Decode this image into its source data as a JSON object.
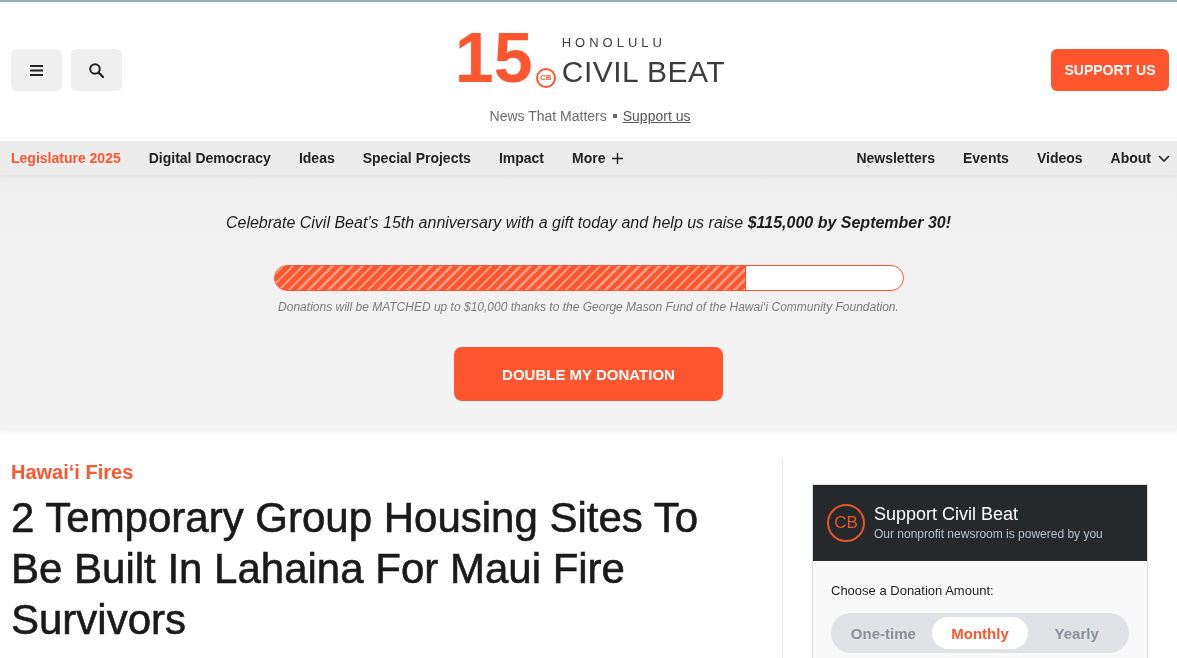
{
  "header": {
    "logo": {
      "number": "15",
      "badge": "CB",
      "city": "HONOLULU",
      "name": "CIVIL BEAT"
    },
    "tagline": "News That Matters",
    "tagline_link": "Support us",
    "support_button": "SUPPORT US"
  },
  "nav": {
    "left": [
      {
        "label": "Legislature 2025",
        "kind": "featured"
      },
      {
        "label": "Digital Democracy",
        "kind": "link"
      },
      {
        "label": "Ideas",
        "kind": "link"
      },
      {
        "label": "Special Projects",
        "kind": "link"
      },
      {
        "label": "Impact",
        "kind": "link"
      },
      {
        "label": "More",
        "kind": "more"
      }
    ],
    "right": [
      {
        "label": "Newsletters",
        "kind": "link"
      },
      {
        "label": "Events",
        "kind": "link"
      },
      {
        "label": "Videos",
        "kind": "link"
      },
      {
        "label": "About",
        "kind": "dropdown"
      }
    ]
  },
  "banner": {
    "message": "Celebrate Civil Beat’s 15th anniversary with a gift today and help us raise **$115,000 by September 30!**",
    "progress": {
      "level": 0.75
    },
    "note": "Donations will be MATCHED up to $10,000 thanks to the George Mason Fund of the Hawai‘i Community Foundation.",
    "button": "DOUBLE MY DONATION"
  },
  "article": {
    "category": "Hawai‘i Fires",
    "headline": "2 Temporary Group Housing Sites To Be Built In Lahaina For Maui Fire Survivors"
  },
  "donation_widget": {
    "logo": "CB",
    "title": "Support Civil Beat",
    "subtitle": "Our nonprofit newsroom is powered by you",
    "prompt": "Choose a Donation Amount:",
    "frequencies": [
      {
        "label": "One-time",
        "selected": false
      },
      {
        "label": "Monthly",
        "selected": true
      },
      {
        "label": "Yearly",
        "selected": false
      }
    ]
  }
}
